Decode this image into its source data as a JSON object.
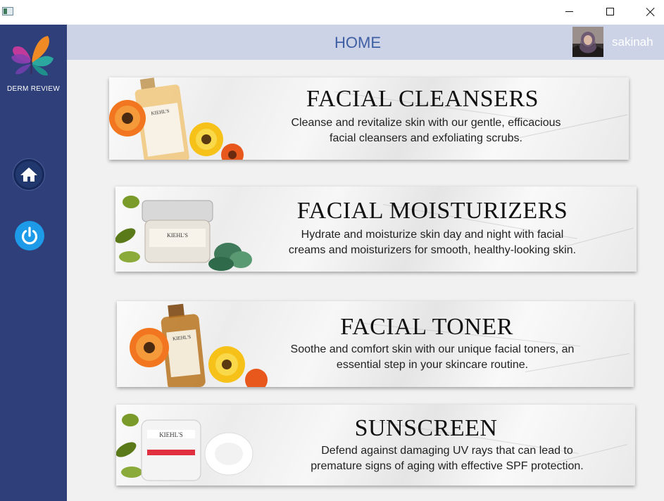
{
  "window": {
    "title": ""
  },
  "titlebar": {
    "minimize": "minimize",
    "maximize": "maximize",
    "close": "close"
  },
  "sidebar": {
    "logo_text": "DERM REVIEW",
    "nav": [
      {
        "icon": "home-icon"
      },
      {
        "icon": "power-icon"
      }
    ]
  },
  "header": {
    "title": "HOME",
    "user": {
      "name": "sakinah"
    }
  },
  "categories": [
    {
      "title": "FACIAL CLEANSERS",
      "desc_line1": "Cleanse and revitalize skin with our gentle, efficacious",
      "desc_line2": "facial cleansers and exfoliating scrubs.",
      "brand": "KIEHL'S"
    },
    {
      "title": "FACIAL MOISTURIZERS",
      "desc_line1": "Hydrate and moisturize skin day and night with facial",
      "desc_line2": "creams and moisturizers for smooth, healthy-looking skin.",
      "brand": "KIEHL'S"
    },
    {
      "title": "FACIAL TONER",
      "desc_line1": "Soothe and comfort skin with our unique facial toners, an",
      "desc_line2": "essential step in your skincare routine.",
      "brand": "KIEHL'S"
    },
    {
      "title": "SUNSCREEN",
      "desc_line1": "Defend against damaging UV rays that can lead to",
      "desc_line2": "premature signs of aging with effective SPF protection.",
      "brand": "KIEHL'S"
    }
  ],
  "colors": {
    "sidebar": "#2e3f7a",
    "header": "#ccd3e6",
    "header_title": "#3f5fa4",
    "power_button": "#1e9be8"
  }
}
